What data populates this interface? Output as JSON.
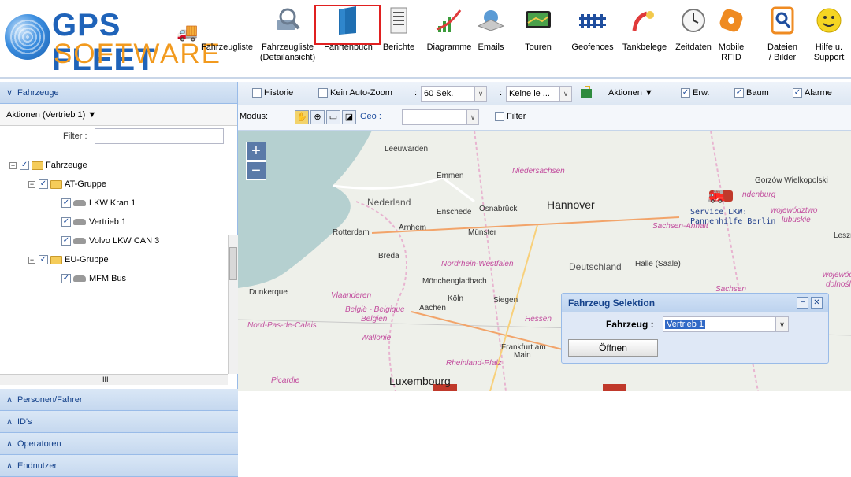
{
  "logo": {
    "line1": "GPS FLEET",
    "line2": "SOFTWARE"
  },
  "toolbar": [
    {
      "label": "Fahrzeugliste",
      "label2": "",
      "icon": "truck-list-icon"
    },
    {
      "label": "Fahrzeugliste",
      "label2": "(Detailansicht)",
      "icon": "magnifier-truck-icon"
    },
    {
      "label": "Fahrtenbuch",
      "label2": "",
      "icon": "logbook-icon"
    },
    {
      "label": "Berichte",
      "label2": "",
      "icon": "report-icon"
    },
    {
      "label": "Diagramme",
      "label2": "",
      "icon": "chart-icon"
    },
    {
      "label": "Emails",
      "label2": "",
      "icon": "email-icon"
    },
    {
      "label": "Touren",
      "label2": "",
      "icon": "tour-icon"
    },
    {
      "label": "Geofences",
      "label2": "",
      "icon": "fence-icon"
    },
    {
      "label": "Tankbelege",
      "label2": "",
      "icon": "fuel-icon"
    },
    {
      "label": "Zeitdaten",
      "label2": "",
      "icon": "clock-icon"
    },
    {
      "label": "Mobile",
      "label2": "RFID",
      "icon": "rfid-icon"
    },
    {
      "label": "Dateien",
      "label2": "/ Bilder",
      "icon": "files-icon"
    },
    {
      "label": "Hilfe u.",
      "label2": "Support",
      "icon": "help-icon"
    }
  ],
  "left": {
    "fahrzeuge": "Fahrzeuge",
    "aktionen": "Aktionen (Vertrieb 1)",
    "filter_label": "Filter :",
    "tree": {
      "root": "Fahrzeuge",
      "g1": "AT-Gruppe",
      "v1": "LKW Kran 1",
      "v2": "Vertrieb 1",
      "v3": "Volvo LKW CAN 3",
      "g2": "EU-Gruppe",
      "v4": "MFM Bus"
    },
    "hscroll_mark": "III",
    "sections": [
      "Personen/Fahrer",
      "ID's",
      "Operatoren",
      "Endnutzer"
    ]
  },
  "maptb": {
    "historie": "Historie",
    "autozoom": "Kein Auto-Zoom",
    "interval": "60 Sek.",
    "keine": "Keine le ...",
    "aktionen": "Aktionen",
    "erw": "Erw.",
    "baum": "Baum",
    "alarme": "Alarme",
    "modus": "Modus:",
    "geo": "Geo :",
    "filter": "Filter"
  },
  "map": {
    "labels": {
      "leeuwarden": "Leeuwarden",
      "emmen": "Emmen",
      "niedersachsen": "Niedersachsen",
      "nederland": "Nederland",
      "enschede": "Enschede",
      "osnabrueck": "Osnabrück",
      "hannover": "Hannover",
      "rotterdam": "Rotterdam",
      "arnhem": "Arnhem",
      "muenster": "Münster",
      "sachsenanhalt": "Sachsen-Anhalt",
      "breda": "Breda",
      "nrw": "Nordrhein-Westfalen",
      "deutschland": "Deutschland",
      "halle": "Halle (Saale)",
      "moenchengladbach": "Mönchengladbach",
      "duenkerque": "Dunkerque",
      "vlaanderen": "Vlaanderen",
      "koeln": "Köln",
      "siegen": "Siegen",
      "belgie": "België - Belgique",
      "belgien": "Belgien",
      "aachen": "Aachen",
      "nordpas": "Nord-Pas-de-Calais",
      "wallonie": "Wallonie",
      "hessen": "Hessen",
      "frankfurt": "Frankfurt am",
      "main": "Main",
      "rlp": "Rheinland-Pfalz",
      "luxembourg": "Luxembourg",
      "picardie": "Picardie",
      "gorzow": "Gorzów Wielkopolski",
      "brandenburg": "ndenburg",
      "wojewodztwo": "województwo",
      "lubuskie": "lubuskie",
      "leszno": "Leszn",
      "sachsen": "Sachsen",
      "wojew2": "wojewódz",
      "dolno": "dolnośląs",
      "service1": "Service LKW:",
      "service2": "Pannenhilfe Berlin"
    }
  },
  "dialog": {
    "title": "Fahrzeug Selektion",
    "fahrzeug_label": "Fahrzeug :",
    "selected": "Vertrieb 1",
    "open": "Öffnen"
  }
}
